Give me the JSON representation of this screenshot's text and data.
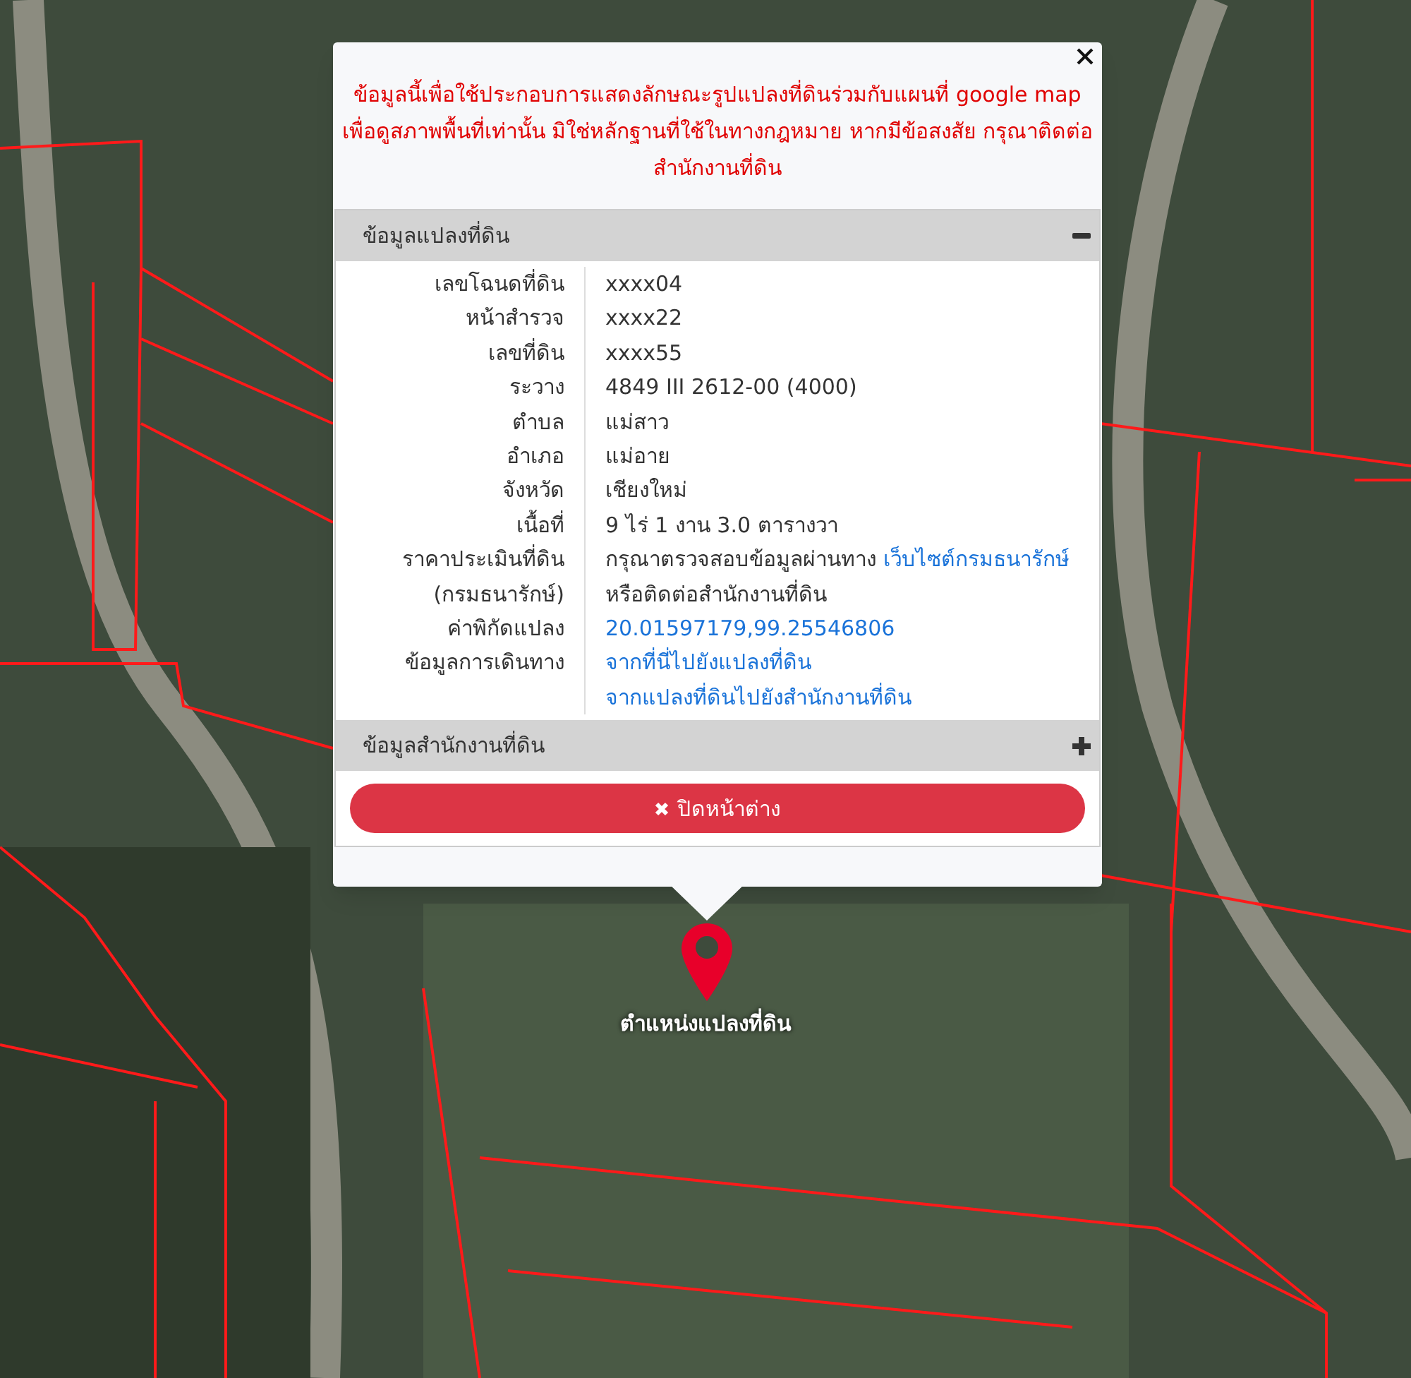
{
  "notice": "ข้อมูลนี้เพื่อใช้ประกอบการแสดงลักษณะรูปแปลงที่ดินร่วมกับแผนที่ google map เพื่อดูสภาพพื้นที่เท่านั้น มิใช่หลักฐานที่ใช้ในทางกฎหมาย หากมีข้อสงสัย กรุณาติดต่อสำนักงานที่ดิน",
  "sections": [
    {
      "title": "ข้อมูลแปลงที่ดิน",
      "expanded": true,
      "rows": [
        {
          "label": "เลขโฉนดที่ดิน",
          "value": [
            {
              "kind": "text",
              "text": "xxxx04"
            }
          ]
        },
        {
          "label": "หน้าสำรวจ",
          "value": [
            {
              "kind": "text",
              "text": "xxxx22"
            }
          ]
        },
        {
          "label": "เลขที่ดิน",
          "value": [
            {
              "kind": "text",
              "text": "xxxx55"
            }
          ]
        },
        {
          "label": "ระวาง",
          "value": [
            {
              "kind": "text",
              "text": "4849 III 2612-00 (4000)"
            }
          ]
        },
        {
          "label": "ตำบล",
          "value": [
            {
              "kind": "text",
              "text": "แม่สาว"
            }
          ]
        },
        {
          "label": "อำเภอ",
          "value": [
            {
              "kind": "text",
              "text": "แม่อาย"
            }
          ]
        },
        {
          "label": "จังหวัด",
          "value": [
            {
              "kind": "text",
              "text": "เชียงใหม่"
            }
          ]
        },
        {
          "label": "เนื้อที่",
          "value": [
            {
              "kind": "text",
              "text": "9 ไร่ 1 งาน 3.0 ตารางวา"
            }
          ]
        },
        {
          "label": "ราคาประเมินที่ดิน",
          "value": [
            {
              "kind": "text",
              "text": "กรุณาตรวจสอบข้อมูลผ่านทาง"
            },
            {
              "kind": "link",
              "text": "เว็บไซต์กรมธนารักษ์"
            }
          ]
        },
        {
          "label": "(กรมธนารักษ์)",
          "value": [
            {
              "kind": "text",
              "text": "หรือติดต่อสำนักงานที่ดิน"
            }
          ]
        },
        {
          "label": "ค่าพิกัดแปลง",
          "value": [
            {
              "kind": "link",
              "text": "20.01597179,99.25546806"
            }
          ]
        },
        {
          "label": "ข้อมูลการเดินทาง",
          "value": [
            {
              "kind": "link",
              "text": "จากที่นี่ไปยังแปลงที่ดิน"
            }
          ]
        },
        {
          "value": [
            {
              "kind": "link",
              "text": "จากแปลงที่ดินไปยังสำนักงานที่ดิน"
            }
          ]
        }
      ]
    },
    {
      "title": "ข้อมูลสำนักงานที่ดิน",
      "expanded": false
    }
  ],
  "close_button": "ปิดหน้าต่าง",
  "marker_label": "ตำแหน่งแปลงที่ดิน"
}
